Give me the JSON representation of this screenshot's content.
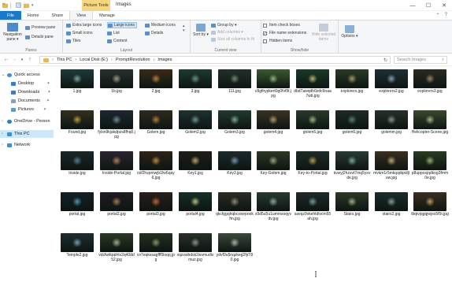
{
  "window": {
    "title": "Images",
    "context_tab": "Picture Tools",
    "controls": [
      "—",
      "☐",
      "✕"
    ]
  },
  "ribbon": {
    "tabs": [
      "File",
      "Home",
      "Share",
      "View",
      "Manage"
    ],
    "panes": {
      "label": "Panes",
      "navigation_pane": "Navigation pane ▾",
      "preview_pane": "Preview pane",
      "details_pane": "Details pane"
    },
    "layout": {
      "label": "Layout",
      "items": [
        "Extra large icons",
        "Large icons",
        "Medium icons",
        "Small icons",
        "List",
        "Details",
        "Tiles",
        "Content"
      ],
      "selected": "Large icons"
    },
    "current_view": {
      "label": "Current view",
      "sort_by": "Sort by ▾",
      "group_by": "Group by ▾",
      "add_columns": "Add columns ▾",
      "size_columns": "Size all columns to fit"
    },
    "show_hide": {
      "label": "Show/hide",
      "item_check_boxes": "Item check boxes",
      "file_name_extensions": "File name extensions",
      "hidden_items": "Hidden items",
      "hide_selected": "Hide selected items",
      "extensions_checked": true
    },
    "options": "Options ▾"
  },
  "address": {
    "breadcrumbs": [
      "This PC",
      "Local Disk (E:)",
      "PromptRevolution",
      "Images"
    ],
    "search_placeholder": "Search Images"
  },
  "nav": {
    "quick_access": "Quick access",
    "desktop": "Desktop",
    "downloads": "Downloads",
    "documents": "Documents",
    "pictures": "Pictures",
    "onedrive": "OneDrive - Person",
    "this_pc": "This PC",
    "network": "Network"
  },
  "files": [
    {
      "name": "1.jpg",
      "bg": "#1f3a3a",
      "glow": "#9ad1c9"
    },
    {
      "name": "1b.jpg",
      "bg": "#2a3030",
      "glow": "#c8c0a0"
    },
    {
      "name": "2.jpg",
      "bg": "#3a2a18",
      "glow": "#e0a050"
    },
    {
      "name": "3.jpg",
      "bg": "#1e3a30",
      "glow": "#7ab8a0"
    },
    {
      "name": "111.jpg",
      "bg": "#233028",
      "glow": "#8fa890"
    },
    {
      "name": "c8gthypkert0g0fvf9t.jpg",
      "bg": "#3c5a32",
      "glow": "#b8d8a0"
    },
    {
      "name": "dbd7awqdh0zdc6naa7wb.jpg",
      "bg": "#1a3a2a",
      "glow": "#f0e080"
    },
    {
      "name": "explorers.jpg",
      "bg": "#2a3a28",
      "glow": "#d0c080"
    },
    {
      "name": "explorers2.jpg",
      "bg": "#1f2f35",
      "glow": "#a0c8e0"
    },
    {
      "name": "explorers3.jpg",
      "bg": "#2a2a22",
      "glow": "#c0a870"
    },
    {
      "name": "Found.jpg",
      "bg": "#33301f",
      "glow": "#f0c040"
    },
    {
      "name": "fylsn9kjakdpzs8fhq0.jpg",
      "bg": "#1c2830",
      "glow": "#90b0c0"
    },
    {
      "name": "Golem.jpg",
      "bg": "#2e2a20",
      "glow": "#e0a040"
    },
    {
      "name": "Golem2.jpg",
      "bg": "#1e3230",
      "glow": "#80c0b0"
    },
    {
      "name": "Golem3.jpg",
      "bg": "#233a2e",
      "glow": "#a0d0b0"
    },
    {
      "name": "golem4.jpg",
      "bg": "#3a3226",
      "glow": "#e0c080"
    },
    {
      "name": "golem5.jpg",
      "bg": "#2a3a2a",
      "glow": "#c0e0a0"
    },
    {
      "name": "golem6.jpg",
      "bg": "#1e2a26",
      "glow": "#70a090"
    },
    {
      "name": "golemm.jpg",
      "bg": "#28302a",
      "glow": "#a0b8a0"
    },
    {
      "name": "Helicopter-Scene.jpg",
      "bg": "#3a4a30",
      "glow": "#d0e0b0"
    },
    {
      "name": "Inside.jpg",
      "bg": "#1a2628",
      "glow": "#60a0b0"
    },
    {
      "name": "Inside-Portal.jpg",
      "bg": "#2a2430",
      "glow": "#e0a060"
    },
    {
      "name": "ioif2hspmwjb1fw6qay6.jpg",
      "bg": "#2c2218",
      "glow": "#f0b040"
    },
    {
      "name": "Key1.jpg",
      "bg": "#201e18",
      "glow": "#f0d080"
    },
    {
      "name": "Key3.jpg",
      "bg": "#1c2a2c",
      "glow": "#90c0d0"
    },
    {
      "name": "Key-Golem.jpg",
      "bg": "#2e3626",
      "glow": "#c0d090"
    },
    {
      "name": "Key-to-Portal.jpg",
      "bg": "#1e2c24",
      "glow": "#f0c060"
    },
    {
      "name": "kvwyj2hzxvt7mq5yxvde.jpg",
      "bg": "#2a3a34",
      "glow": "#a0d0c0"
    },
    {
      "name": "mvkm1r5mkqqdqxdjluw.jpg",
      "bg": "#3a3020",
      "glow": "#f0d090"
    },
    {
      "name": "p8upposjqdkog3fmm0e.jpg",
      "bg": "#2a3a22",
      "glow": "#c0e080"
    },
    {
      "name": "portal.jpg",
      "bg": "#142026",
      "glow": "#60c0e0"
    },
    {
      "name": "portal2.jpg",
      "bg": "#1e1c22",
      "glow": "#d0a060"
    },
    {
      "name": "portal3.jpg",
      "bg": "#2a1e1a",
      "glow": "#f08040"
    },
    {
      "name": "portal4.jpg",
      "bg": "#163028",
      "glow": "#f0f0a0"
    },
    {
      "name": "qkcfggqhqbcxwvpookfm.jpg",
      "bg": "#2a2c24",
      "glow": "#b0b090"
    },
    {
      "name": "s9d5u5u1ummsoqyvdv.jpg",
      "bg": "#2a3a30",
      "glow": "#b0d0c0"
    },
    {
      "name": "savqz0vkehtdlvcm55ah.jpg",
      "bg": "#1e2a2a",
      "glow": "#90c0c0"
    },
    {
      "name": "Stairs.jpg",
      "bg": "#2e3826",
      "glow": "#d0d8a0"
    },
    {
      "name": "stairs2.jpg",
      "bg": "#1c2c2a",
      "glow": "#a0c8b8"
    },
    {
      "name": "tbqivjqgqjwjso5f5t.jpg",
      "bg": "#3a2e20",
      "glow": "#f0c070"
    },
    {
      "name": "Temple2.jpg",
      "bg": "#1e2c30",
      "glow": "#90c8e0"
    },
    {
      "name": "vdcfwtkpphtv2q40dd52.jpg",
      "bg": "#2c3826",
      "glow": "#c8e0a0"
    },
    {
      "name": "vv7eqkssagfff5loqq.jpg",
      "bg": "#243020",
      "glow": "#a0c080"
    },
    {
      "name": "xqzswbdsk2wvmudivmuz.jpg",
      "bg": "#2a2e28",
      "glow": "#b0b8a8"
    },
    {
      "name": "ydvf0u5nqzkeg2fpT80.jpg",
      "bg": "#3a4a3a",
      "glow": "#d0e0d0"
    }
  ]
}
